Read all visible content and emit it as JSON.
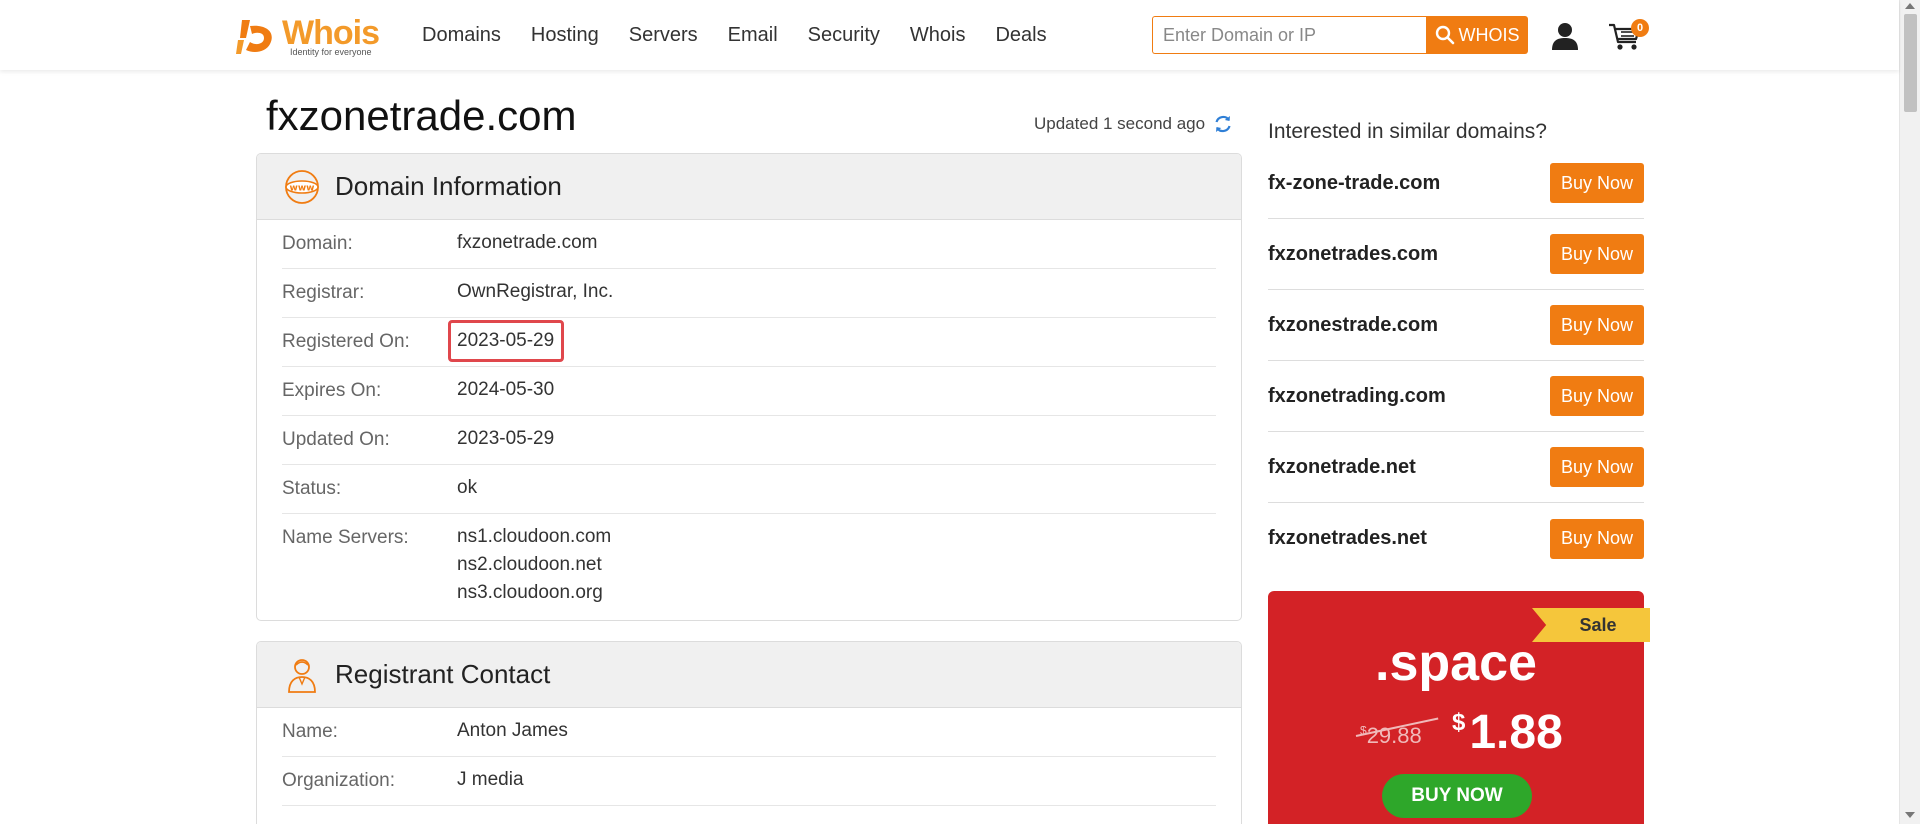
{
  "header": {
    "logo_text": "Whois",
    "logo_tagline": "Identity for everyone",
    "nav": [
      "Domains",
      "Hosting",
      "Servers",
      "Email",
      "Security",
      "Whois",
      "Deals"
    ],
    "search_placeholder": "Enter Domain or IP",
    "search_button": "WHOIS",
    "cart_count": "0"
  },
  "page": {
    "title": "fxzonetrade.com",
    "updated": "Updated 1 second ago"
  },
  "domain_info": {
    "title": "Domain Information",
    "rows": [
      {
        "label": "Domain:",
        "value": "fxzonetrade.com"
      },
      {
        "label": "Registrar:",
        "value": "OwnRegistrar, Inc."
      },
      {
        "label": "Registered On:",
        "value": "2023-05-29"
      },
      {
        "label": "Expires On:",
        "value": "2024-05-30"
      },
      {
        "label": "Updated On:",
        "value": "2023-05-29"
      },
      {
        "label": "Status:",
        "value": "ok"
      },
      {
        "label": "Name Servers:",
        "values": [
          "ns1.cloudoon.com",
          "ns2.cloudoon.net",
          "ns3.cloudoon.org"
        ]
      }
    ]
  },
  "registrant": {
    "title": "Registrant Contact",
    "rows": [
      {
        "label": "Name:",
        "value": "Anton James"
      },
      {
        "label": "Organization:",
        "value": "J media"
      }
    ]
  },
  "sidebar": {
    "title": "Interested in similar domains?",
    "buy_label": "Buy Now",
    "suggestions": [
      "fx-zone-trade.com",
      "fxzonetrades.com",
      "fxzonestrade.com",
      "fxzonetrading.com",
      "fxzonetrade.net",
      "fxzonetrades.net"
    ]
  },
  "promo": {
    "ribbon": "Sale",
    "tld": ".space",
    "old_currency": "$",
    "old_price": "29.88",
    "new_currency": "$",
    "new_price": "1.88",
    "button": "BUY NOW"
  },
  "colors": {
    "accent": "#f07c12",
    "promo_bg": "#d32226",
    "promo_button": "#2ea72a",
    "ribbon": "#f5c63b",
    "highlight": "#e0474c"
  }
}
